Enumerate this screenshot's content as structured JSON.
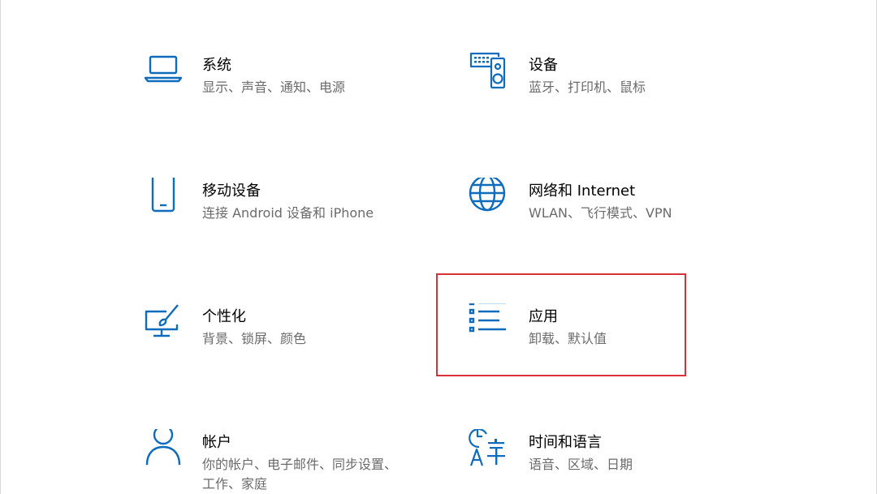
{
  "accent_color": "#0f6cbd",
  "highlight_color": "#d9303a",
  "tiles": {
    "system": {
      "icon": "laptop-icon",
      "title": "系统",
      "desc": "显示、声音、通知、电源"
    },
    "devices": {
      "icon": "keyboard-speaker-icon",
      "title": "设备",
      "desc": "蓝牙、打印机、鼠标"
    },
    "phone": {
      "icon": "phone-icon",
      "title": "移动设备",
      "desc": "连接 Android 设备和 iPhone"
    },
    "network": {
      "icon": "globe-icon",
      "title": "网络和 Internet",
      "desc": "WLAN、飞行模式、VPN"
    },
    "personalization": {
      "icon": "paint-monitor-icon",
      "title": "个性化",
      "desc": "背景、锁屏、颜色"
    },
    "apps": {
      "icon": "apps-list-icon",
      "title": "应用",
      "desc": "卸载、默认值"
    },
    "accounts": {
      "icon": "person-icon",
      "title": "帐户",
      "desc": "你的帐户、电子邮件、同步设置、工作、家庭"
    },
    "time_language": {
      "icon": "time-language-icon",
      "title": "时间和语言",
      "desc": "语音、区域、日期"
    }
  }
}
